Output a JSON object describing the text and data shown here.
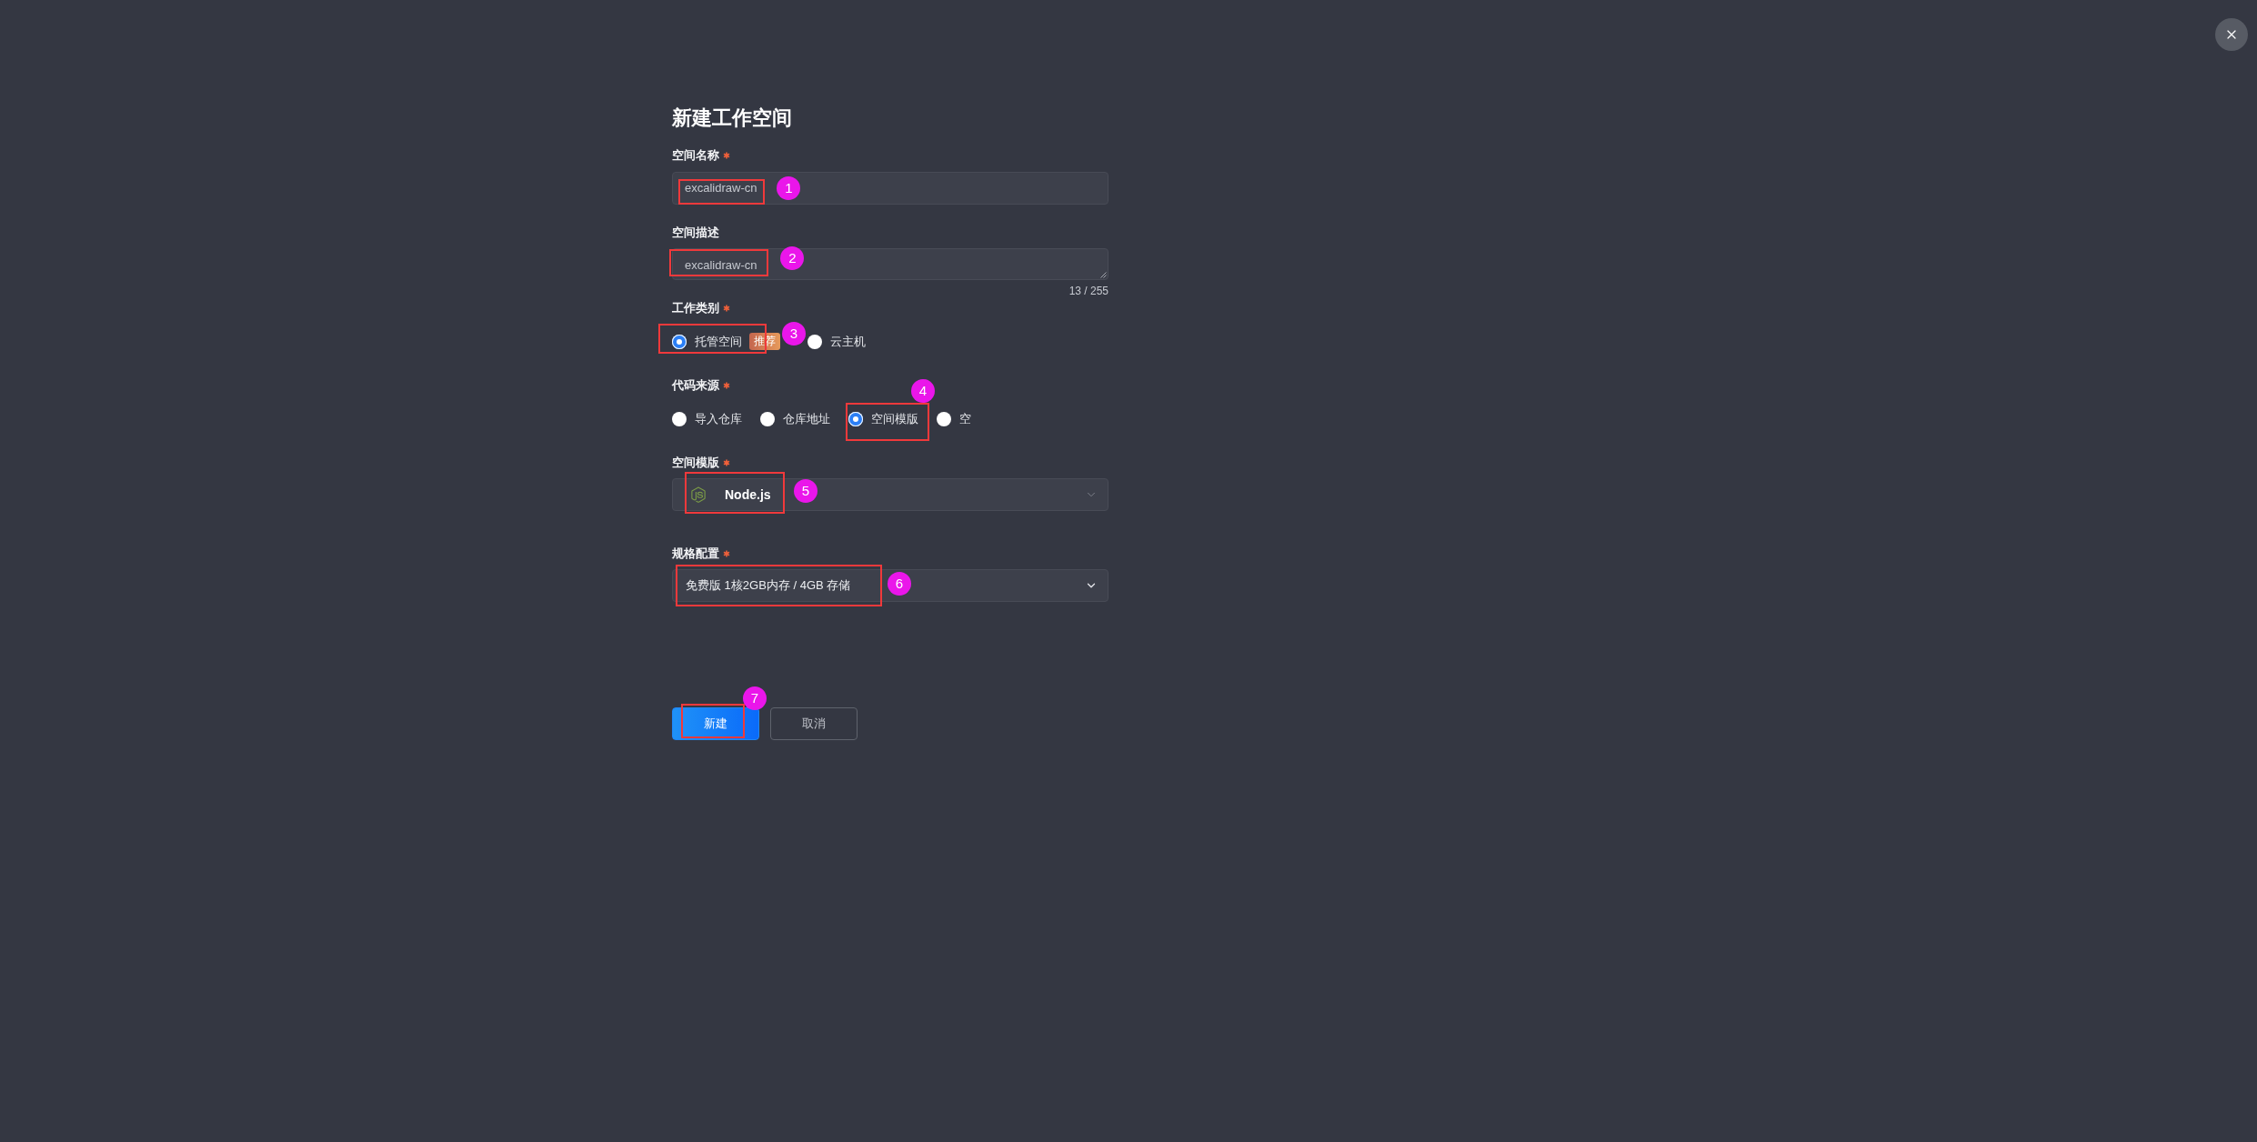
{
  "dialog": {
    "title": "新建工作空间"
  },
  "fields": [
    {
      "kind": "text",
      "label": "空间名称",
      "required": true,
      "value": "excalidraw-cn",
      "callout": "1"
    },
    {
      "kind": "textarea",
      "label": "空间描述",
      "required": false,
      "value": "excalidraw-cn",
      "counter": "13 / 255",
      "callout": "2"
    },
    {
      "kind": "radio",
      "label": "工作类别",
      "required": true,
      "options": [
        {
          "label": "托管空间",
          "selected": true,
          "badge": "推荐",
          "callout": "3"
        },
        {
          "label": "云主机",
          "selected": false
        }
      ]
    },
    {
      "kind": "radio",
      "label": "代码来源",
      "required": true,
      "options": [
        {
          "label": "导入仓库",
          "selected": false
        },
        {
          "label": "仓库地址",
          "selected": false
        },
        {
          "label": "空间模版",
          "selected": true,
          "callout": "4"
        },
        {
          "label": "空",
          "selected": false
        }
      ]
    },
    {
      "kind": "template",
      "label": "空间模版",
      "required": true,
      "value": "Node.js",
      "callout": "5"
    },
    {
      "kind": "select",
      "label": "规格配置",
      "required": true,
      "value": "免费版 1核2GB内存 / 4GB 存储",
      "callout": "6"
    }
  ],
  "buttons": [
    {
      "kind": "primary",
      "label": "新建",
      "callout": "7"
    },
    {
      "kind": "secondary",
      "label": "取消"
    }
  ]
}
